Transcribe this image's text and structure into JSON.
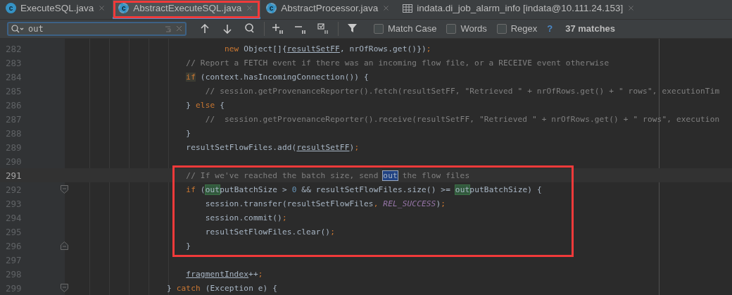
{
  "tabs": [
    {
      "label": "ExecuteSQL.java",
      "kind": "class",
      "icon_letter": "c",
      "selected": false,
      "annotated": false
    },
    {
      "label": "AbstractExecuteSQL.java",
      "kind": "abstract-class",
      "icon_letter": "c",
      "selected": true,
      "annotated": true
    },
    {
      "label": "AbstractProcessor.java",
      "kind": "abstract-class",
      "icon_letter": "c",
      "selected": false,
      "annotated": false
    },
    {
      "label": "indata.di_job_alarm_info [indata@10.111.24.153]",
      "kind": "table",
      "selected": false,
      "annotated": false
    }
  ],
  "find_bar": {
    "search": {
      "value": "out"
    },
    "options": [
      {
        "label": "Match Case",
        "checked": false
      },
      {
        "label": "Words",
        "checked": false
      },
      {
        "label": "Regex",
        "checked": false
      }
    ],
    "help": "?",
    "match_count": "37 matches"
  },
  "code": {
    "blocks": [
      {
        "annotated": false,
        "lines": [
          {
            "number": "282",
            "current": false,
            "fold_start": false,
            "fold_end": false,
            "tokens": [
              {
                "kind": "keyword",
                "text": "            new"
              },
              {
                "kind": "plain",
                "text": " Object[]{"
              },
              {
                "kind": "underlined",
                "text": "resultSetFF"
              },
              {
                "kind": "plain",
                "text": ", nrOfRows.get()})"
              },
              {
                "kind": "punct",
                "text": ";"
              }
            ]
          },
          {
            "number": "283",
            "current": false,
            "fold_start": false,
            "fold_end": false,
            "tokens": [
              {
                "kind": "comment",
                "text": "    // Report a FETCH event if there was an incoming flow file, or a RECEIVE event otherwise"
              }
            ]
          },
          {
            "number": "284",
            "current": false,
            "fold_start": false,
            "fold_end": false,
            "tokens": [
              {
                "kind": "keyword-highlight",
                "text": "    if"
              },
              {
                "kind": "plain",
                "text": " (context.hasIncomingConnection()) {"
              }
            ]
          },
          {
            "number": "285",
            "current": false,
            "fold_start": false,
            "fold_end": false,
            "tokens": [
              {
                "kind": "comment",
                "text": "        // session.getProvenanceReporter().fetch(resultSetFF, \"Retrieved \" + nrOfRows.get() + \" rows\", executionTim"
              }
            ]
          },
          {
            "number": "286",
            "current": false,
            "fold_start": false,
            "fold_end": false,
            "tokens": [
              {
                "kind": "plain",
                "text": "    } "
              },
              {
                "kind": "keyword",
                "text": "else"
              },
              {
                "kind": "plain",
                "text": " {"
              }
            ]
          },
          {
            "number": "287",
            "current": false,
            "fold_start": false,
            "fold_end": false,
            "tokens": [
              {
                "kind": "comment",
                "text": "        //  session.getProvenanceReporter().receive(resultSetFF, \"Retrieved \" + nrOfRows.get() + \" rows\", execution"
              }
            ]
          },
          {
            "number": "288",
            "current": false,
            "fold_start": false,
            "fold_end": false,
            "tokens": [
              {
                "kind": "plain",
                "text": "    }"
              }
            ]
          },
          {
            "number": "289",
            "current": false,
            "fold_start": false,
            "fold_end": false,
            "tokens": [
              {
                "kind": "plain",
                "text": "    resultSetFlowFiles.add("
              },
              {
                "kind": "underlined",
                "text": "resultSetFF"
              },
              {
                "kind": "plain",
                "text": ")"
              },
              {
                "kind": "punct",
                "text": ";"
              }
            ]
          },
          {
            "number": "290",
            "current": false,
            "fold_start": false,
            "fold_end": false
          }
        ]
      },
      {
        "annotated": true,
        "lines": [
          {
            "number": "291",
            "current": true,
            "fold_start": false,
            "fold_end": false,
            "tokens": [
              {
                "kind": "comment",
                "text": "    // If we've reached the batch size, send "
              },
              {
                "kind": "current-match",
                "text": "out"
              },
              {
                "kind": "comment",
                "text": " the flow files"
              }
            ]
          },
          {
            "number": "292",
            "current": false,
            "fold_start": true,
            "fold_end": false,
            "tokens": [
              {
                "kind": "keyword",
                "text": "    if"
              },
              {
                "kind": "plain",
                "text": " ("
              },
              {
                "kind": "match",
                "text": "out"
              },
              {
                "kind": "plain",
                "text": "putBatchSize > "
              },
              {
                "kind": "number",
                "text": "0"
              },
              {
                "kind": "plain",
                "text": " && resultSetFlowFiles.size() >= "
              },
              {
                "kind": "match",
                "text": "out"
              },
              {
                "kind": "plain",
                "text": "putBatchSize) {"
              }
            ]
          },
          {
            "number": "293",
            "current": false,
            "fold_start": false,
            "fold_end": false,
            "tokens": [
              {
                "kind": "plain",
                "text": "        session.transfer(resultSetFlowFiles"
              },
              {
                "kind": "punct",
                "text": ", "
              },
              {
                "kind": "constant",
                "text": "REL_SUCCESS"
              },
              {
                "kind": "plain",
                "text": ")"
              },
              {
                "kind": "punct",
                "text": ";"
              }
            ]
          },
          {
            "number": "294",
            "current": false,
            "fold_start": false,
            "fold_end": false,
            "tokens": [
              {
                "kind": "plain",
                "text": "        session.commit()"
              },
              {
                "kind": "punct",
                "text": ";"
              }
            ]
          },
          {
            "number": "295",
            "current": false,
            "fold_start": false,
            "fold_end": false,
            "tokens": [
              {
                "kind": "plain",
                "text": "        resultSetFlowFiles.clear()"
              },
              {
                "kind": "punct",
                "text": ";"
              }
            ]
          },
          {
            "number": "296",
            "current": false,
            "fold_start": false,
            "fold_end": true,
            "tokens": [
              {
                "kind": "plain",
                "text": "    }"
              }
            ]
          }
        ]
      },
      {
        "annotated": false,
        "lines": [
          {
            "number": "297",
            "current": false,
            "fold_start": false,
            "fold_end": false
          },
          {
            "number": "298",
            "current": false,
            "fold_start": false,
            "fold_end": false,
            "tokens": [
              {
                "kind": "underlined",
                "text": "    fragmentIndex"
              },
              {
                "kind": "plain",
                "text": "++"
              },
              {
                "kind": "punct",
                "text": ";"
              }
            ]
          },
          {
            "number": "299",
            "current": false,
            "fold_start": true,
            "fold_end": false,
            "tokens": [
              {
                "kind": "plain",
                "text": "} "
              },
              {
                "kind": "keyword",
                "text": "catch"
              },
              {
                "kind": "plain",
                "text": " (Exception e) {"
              }
            ]
          }
        ]
      }
    ]
  }
}
